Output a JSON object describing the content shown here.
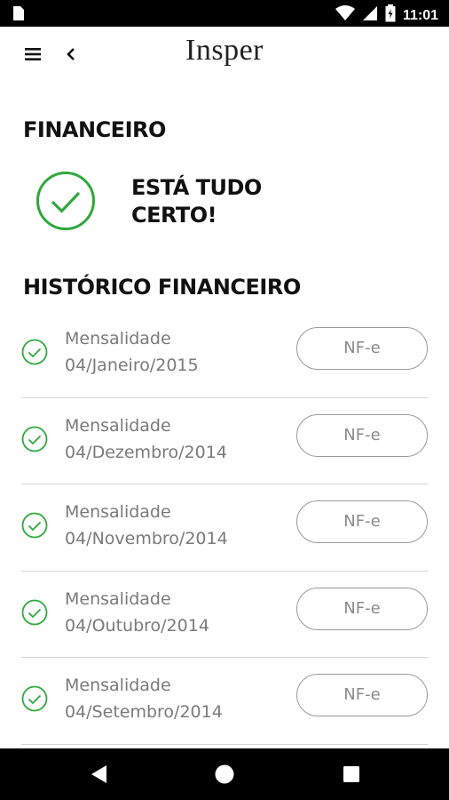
{
  "status_bar": {
    "time": "11:01",
    "icons": [
      "sim-card-icon",
      "wifi-icon",
      "cell-signal-icon",
      "battery-icon"
    ]
  },
  "app_bar": {
    "brand": "Insper",
    "icons": [
      "menu-icon",
      "back-icon"
    ]
  },
  "financial": {
    "title": "FINANCEIRO",
    "status_line1": "ESTÁ TUDO",
    "status_line2": "CERTO!",
    "status_icon": "check-circle-icon"
  },
  "history": {
    "title": "HISTÓRICO FINANCEIRO",
    "items": [
      {
        "title": "Mensalidade",
        "date": "04/Janeiro/2015",
        "button": "NF-e"
      },
      {
        "title": "Mensalidade",
        "date": "04/Dezembro/2014",
        "button": "NF-e"
      },
      {
        "title": "Mensalidade",
        "date": "04/Novembro/2014",
        "button": "NF-e"
      },
      {
        "title": "Mensalidade",
        "date": "04/Outubro/2014",
        "button": "NF-e"
      },
      {
        "title": "Mensalidade",
        "date": "04/Setembro/2014",
        "button": "NF-e"
      }
    ]
  },
  "nav_bar": {
    "icons": [
      "nav-back-icon",
      "nav-home-icon",
      "nav-recent-icon"
    ]
  },
  "colors": {
    "accent_green": "#2fa83c",
    "status_bar": "#000000",
    "text_primary": "#111111",
    "text_secondary": "#7a7a7a"
  }
}
